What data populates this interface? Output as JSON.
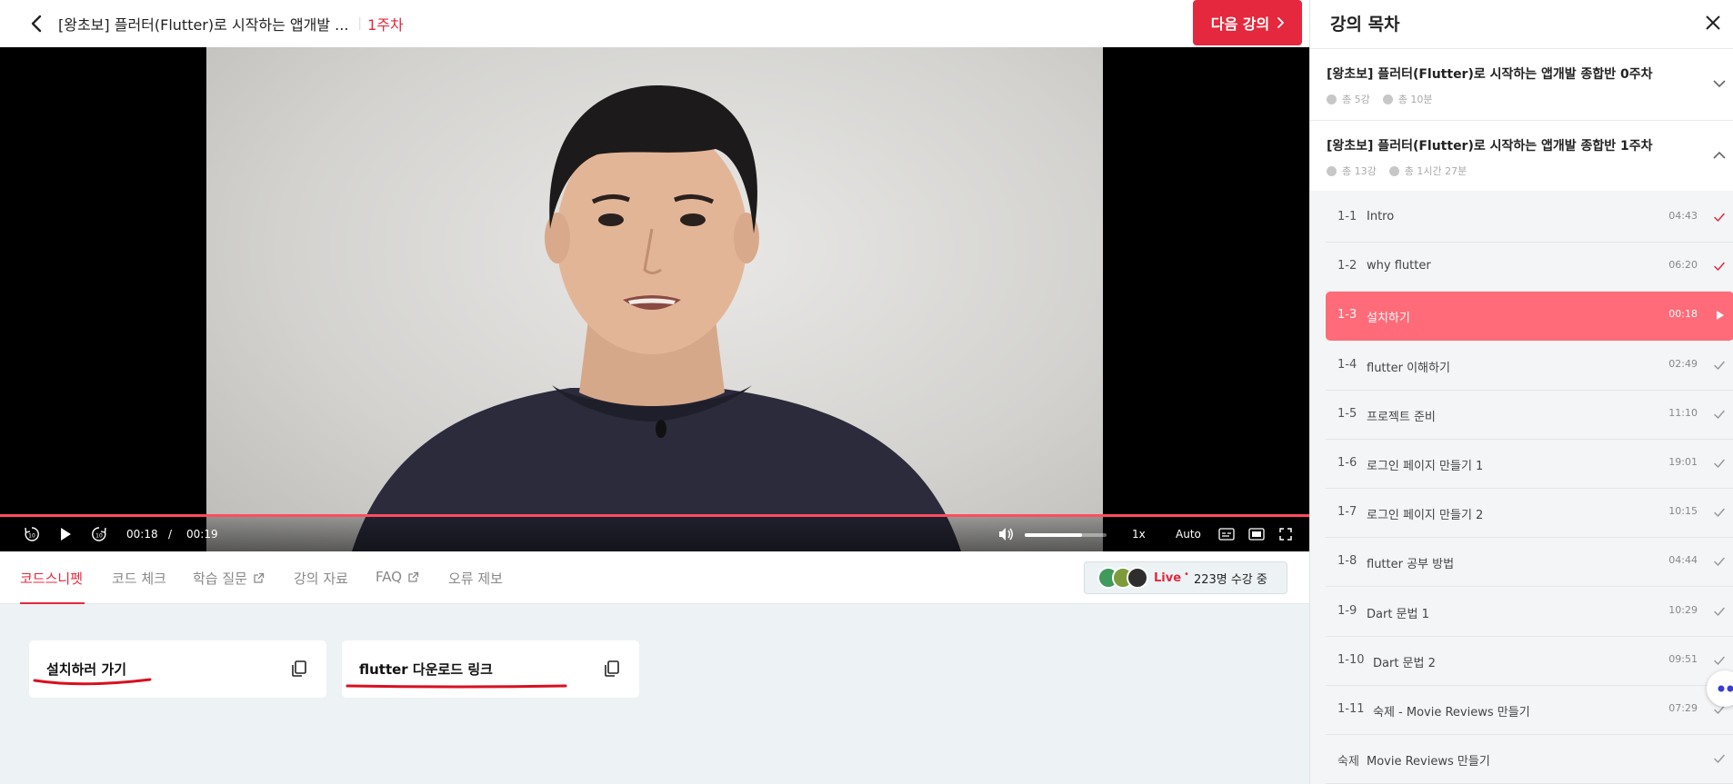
{
  "header": {
    "course_title": "[왕초보] 플러터(Flutter)로 시작하는 앱개발 ...",
    "separator": "|",
    "week_label": "1주차",
    "next_button": "다음 강의"
  },
  "player": {
    "current_time": "00:18",
    "time_separator": "/",
    "duration": "00:19",
    "progress_fraction": 0.99,
    "volume_fraction": 0.7,
    "speed": "1x",
    "quality": "Auto",
    "skip_back_seconds": "10",
    "skip_forward_seconds": "10"
  },
  "tabs": [
    {
      "label": "코드스니펫",
      "active": true
    },
    {
      "label": "코드 체크",
      "active": false
    },
    {
      "label": "학습 질문",
      "active": false,
      "external": true
    },
    {
      "label": "강의 자료",
      "active": false
    },
    {
      "label": "FAQ",
      "active": false,
      "external": true
    },
    {
      "label": "오류 제보",
      "active": false
    }
  ],
  "live": {
    "label": "Live",
    "dot": "•",
    "count_text": "223명 수강 중"
  },
  "snippets": [
    {
      "label": "설치하러 가기"
    },
    {
      "label": "flutter 다운로드 링크"
    }
  ],
  "toc": {
    "title": "강의 목차",
    "weeks": [
      {
        "name": "[왕초보] 플러터(Flutter)로 시작하는 앱개발 종합반 0주차",
        "lessons": "총 5강",
        "time": "총 10분",
        "expanded": false
      },
      {
        "name": "[왕초보] 플러터(Flutter)로 시작하는 앱개발 종합반 1주차",
        "lessons": "총 13강",
        "time": "총 1시간 27분",
        "expanded": true
      }
    ],
    "lessons": [
      {
        "num": "1-1",
        "title": "Intro",
        "duration": "04:43",
        "status": "watched"
      },
      {
        "num": "1-2",
        "title": "why flutter",
        "duration": "06:20",
        "status": "watched"
      },
      {
        "num": "1-3",
        "title": "설치하기",
        "duration": "00:18",
        "status": "playing"
      },
      {
        "num": "1-4",
        "title": "flutter 이해하기",
        "duration": "02:49",
        "status": "unwatched"
      },
      {
        "num": "1-5",
        "title": "프로젝트 준비",
        "duration": "11:10",
        "status": "unwatched"
      },
      {
        "num": "1-6",
        "title": "로그인 페이지 만들기 1",
        "duration": "19:01",
        "status": "unwatched"
      },
      {
        "num": "1-7",
        "title": "로그인 페이지 만들기 2",
        "duration": "10:15",
        "status": "unwatched"
      },
      {
        "num": "1-8",
        "title": "flutter 공부 방법",
        "duration": "04:44",
        "status": "unwatched"
      },
      {
        "num": "1-9",
        "title": "Dart 문법 1",
        "duration": "10:29",
        "status": "unwatched"
      },
      {
        "num": "1-10",
        "title": "Dart 문법 2",
        "duration": "09:51",
        "status": "unwatched"
      },
      {
        "num": "1-11",
        "title": "숙제 - Movie Reviews 만들기",
        "duration": "07:29",
        "status": "unwatched"
      },
      {
        "num": "숙제",
        "title": "Movie Reviews 만들기",
        "duration": "",
        "status": "unwatched"
      }
    ]
  },
  "colors": {
    "accent": "#e5283d",
    "active_lesson": "#ff6b78",
    "watched_check": "#e5283d",
    "unwatched_check": "#999999",
    "panel_bg": "#edf2f5"
  },
  "icons": {
    "back": "chevron-left-icon",
    "next": "chevron-right-icon",
    "close": "close-icon",
    "copy": "copy-icon",
    "external": "external-link-icon",
    "check": "check-icon",
    "play": "play-icon"
  }
}
